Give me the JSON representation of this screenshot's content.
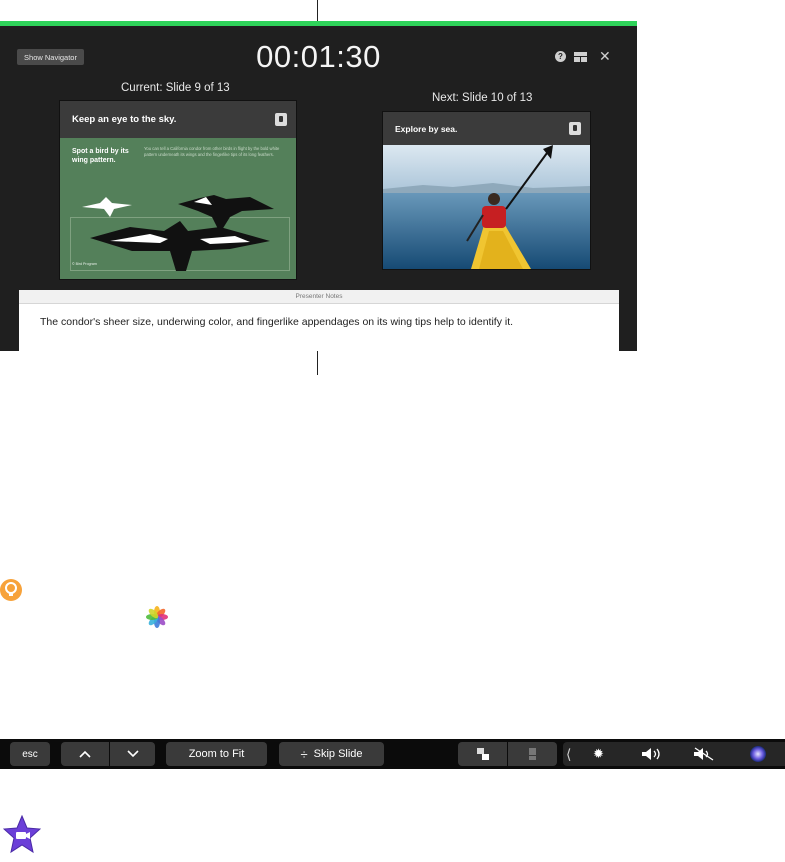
{
  "presenter": {
    "show_navigator_label": "Show Navigator",
    "timer": "00:01:30",
    "current_label": "Current: Slide 9 of 13",
    "next_label": "Next: Slide 10 of 13",
    "icons": [
      "help-icon",
      "layout-icon",
      "close-icon"
    ],
    "current_slide": {
      "title": "Keep an eye to the sky.",
      "heading": "Spot a bird by its wing pattern.",
      "body": "You can tell a California condor from other birds in flight by the bold white pattern underneath its wings and the fingerlike tips of its long feathers.",
      "caption": "© Bird Program"
    },
    "next_slide": {
      "title": "Explore by sea."
    },
    "notes": {
      "header": "Presenter Notes",
      "text": "The condor's sheer size, underwing color, and fingerlike appendages on its wing tips help to identify it."
    },
    "accent_color": "#2fd35a"
  },
  "touchbar": {
    "esc": "esc",
    "up_icon": "chevron-up-icon",
    "down_icon": "chevron-down-icon",
    "zoom": "Zoom to Fit",
    "skip": "Skip Slide",
    "skip_icon": "÷",
    "controls": [
      "chevron-left-icon",
      "brightness-icon",
      "volume-icon",
      "mute-icon",
      "siri-icon"
    ]
  }
}
